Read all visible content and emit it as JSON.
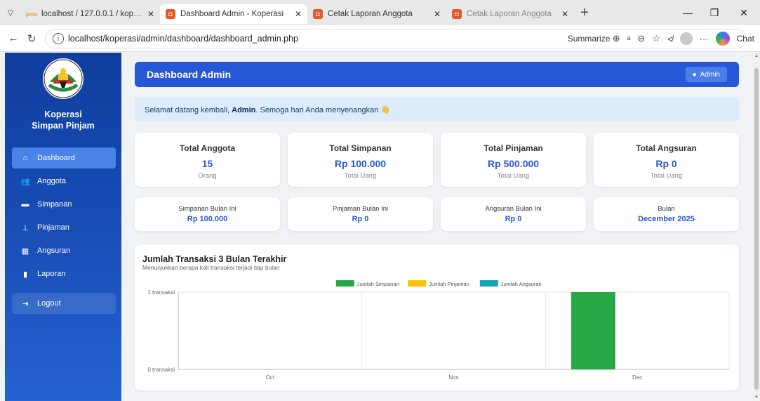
{
  "browser": {
    "tabs": [
      {
        "label": "localhost / 127.0.0.1 / koperasidb",
        "icon": "phpmyadmin-icon",
        "active": false
      },
      {
        "label": "Dashboard Admin - Koperasi",
        "icon": "koperasi-favicon-icon",
        "active": true
      },
      {
        "label": "Cetak Laporan Anggota",
        "icon": "koperasi-favicon-icon",
        "active": false
      },
      {
        "label": "Cetak Laporan Anggota",
        "icon": "koperasi-favicon-icon",
        "active": false
      }
    ],
    "url": "localhost/koperasi/admin/dashboard/dashboard_admin.php",
    "summarize_label": "Summarize",
    "chat_label": "Chat"
  },
  "sidebar": {
    "brand_line1": "Koperasi",
    "brand_line2": "Simpan Pinjam",
    "items": [
      {
        "label": "Dashboard",
        "icon": "home-icon",
        "active": true
      },
      {
        "label": "Anggota",
        "icon": "users-icon",
        "active": false
      },
      {
        "label": "Simpanan",
        "icon": "wallet-icon",
        "active": false
      },
      {
        "label": "Pinjaman",
        "icon": "hand-holding-icon",
        "active": false
      },
      {
        "label": "Angsuran",
        "icon": "calendar-icon",
        "active": false
      },
      {
        "label": "Laporan",
        "icon": "file-icon",
        "active": false
      }
    ],
    "logout_label": "Logout"
  },
  "header": {
    "title": "Dashboard Admin",
    "user_label": "Admin"
  },
  "welcome": {
    "prefix": "Selamat datang kembali, ",
    "name": "Admin",
    "suffix": ". Semoga hari Anda menyenangkan 👋"
  },
  "stats": [
    {
      "title": "Total Anggota",
      "value": "15",
      "sub": "Orang"
    },
    {
      "title": "Total Simpanan",
      "value": "Rp 100.000",
      "sub": "Total Uang"
    },
    {
      "title": "Total Pinjaman",
      "value": "Rp 500.000",
      "sub": "Total Uang"
    },
    {
      "title": "Total Angsuran",
      "value": "Rp 0",
      "sub": "Total Uang"
    }
  ],
  "monthly": [
    {
      "title": "Simpanan Bulan Ini",
      "value": "Rp 100.000"
    },
    {
      "title": "Pinjaman Bulan Ini",
      "value": "Rp 0"
    },
    {
      "title": "Angsuran Bulan Ini",
      "value": "Rp 0"
    },
    {
      "title": "Bulan",
      "value": "December 2025"
    }
  ],
  "colors": {
    "primary": "#2657d6",
    "simpanan": "#28a745",
    "pinjaman": "#ffc107",
    "angsuran": "#17a2b8"
  },
  "chart": {
    "title": "Jumlah Transaksi 3 Bulan Terakhir",
    "subtitle": "Menunjukkan berapa kali transaksi terjadi tiap bulan"
  },
  "chart_data": {
    "type": "bar",
    "categories": [
      "Oct",
      "Nov",
      "Dec"
    ],
    "series": [
      {
        "name": "Jumlah Simpanan",
        "values": [
          0,
          0,
          1
        ],
        "color": "#28a745"
      },
      {
        "name": "Jumlah Pinjaman",
        "values": [
          0,
          0,
          0
        ],
        "color": "#ffc107"
      },
      {
        "name": "Jumlah Angsuran",
        "values": [
          0,
          0,
          0
        ],
        "color": "#17a2b8"
      }
    ],
    "yticks": [
      "0 transaksi",
      "1 transaksi"
    ],
    "ylim": [
      0,
      1
    ],
    "grid": true,
    "legend": "top-center"
  }
}
